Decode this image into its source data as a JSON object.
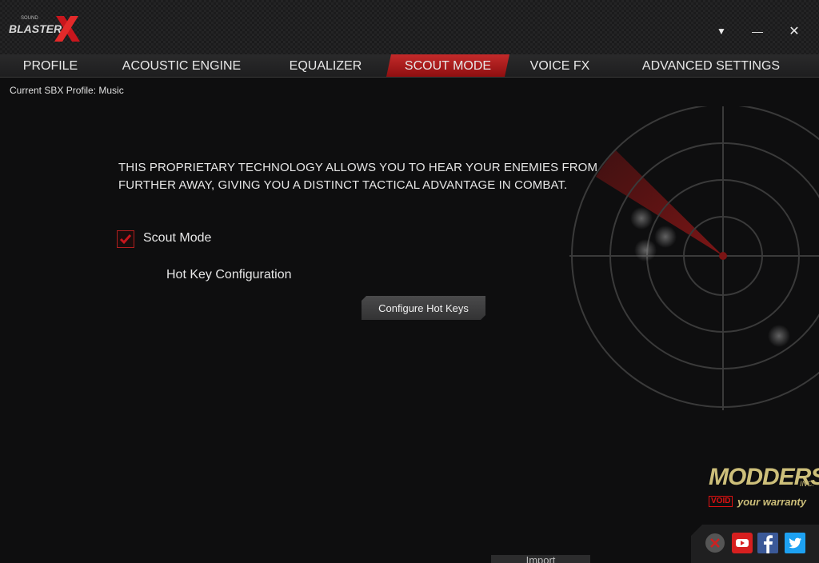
{
  "app": {
    "logo_text": "BLASTER",
    "logo_prefix": "SOUND"
  },
  "window_controls": {
    "dropdown": "▼",
    "minimize": "—",
    "close": "✕"
  },
  "tabs": [
    {
      "label": "PROFILE",
      "active": false
    },
    {
      "label": "ACOUSTIC ENGINE",
      "active": false
    },
    {
      "label": "EQUALIZER",
      "active": false
    },
    {
      "label": "SCOUT MODE",
      "active": true
    },
    {
      "label": "VOICE FX",
      "active": false
    },
    {
      "label": "ADVANCED SETTINGS",
      "active": false
    }
  ],
  "profile": {
    "current_label": "Current SBX Profile: Music"
  },
  "scout": {
    "description_line1": "THIS PROPRIETARY TECHNOLOGY ALLOWS YOU TO HEAR YOUR ENEMIES FROM",
    "description_line2": "FURTHER AWAY, GIVING YOU A DISTINCT TACTICAL ADVANTAGE IN COMBAT.",
    "checkbox_label": "Scout Mode",
    "checkbox_checked": true,
    "hotkey_label": "Hot Key Configuration",
    "hotkey_button": "Configure Hot Keys"
  },
  "watermark": {
    "brand": "MODDERS",
    "inc": "INC.",
    "void": "VOID",
    "tagline": "your warranty"
  },
  "footer": {
    "import_label": "Import"
  },
  "social": [
    {
      "icon": "close-circle-icon"
    },
    {
      "icon": "youtube-icon"
    },
    {
      "icon": "facebook-icon"
    },
    {
      "icon": "twitter-icon"
    }
  ],
  "colors": {
    "accent_red": "#b01e1e",
    "background": "#0e0e0f"
  }
}
